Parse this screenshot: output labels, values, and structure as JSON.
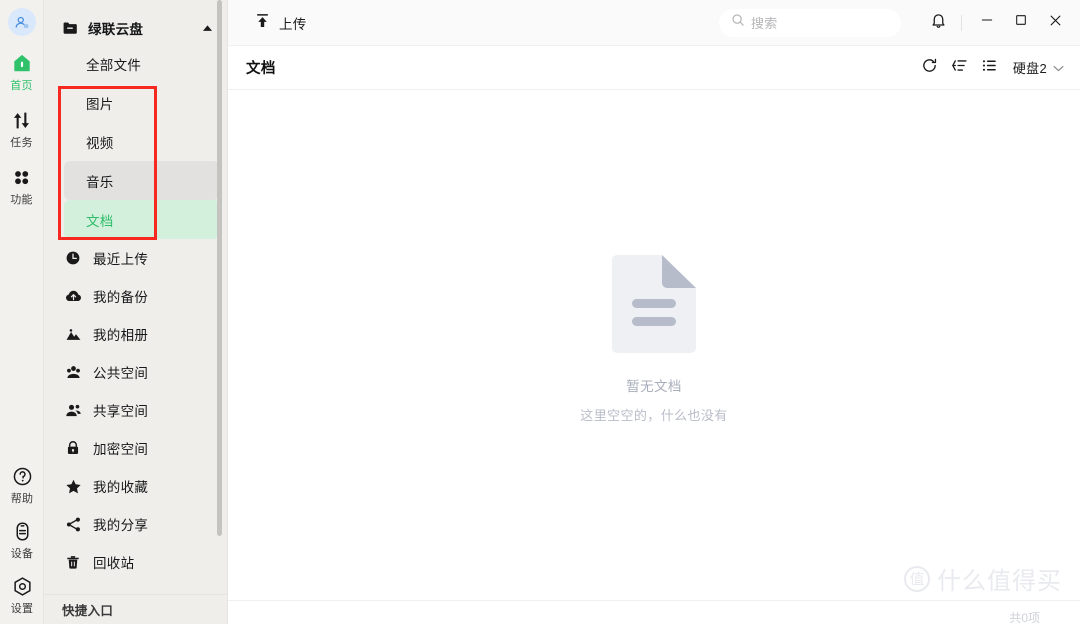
{
  "rail": {
    "avatar_name": "user-avatar",
    "items": [
      {
        "label": "首页",
        "icon": "home-icon",
        "active": true
      },
      {
        "label": "任务",
        "icon": "transfer-icon",
        "active": false
      },
      {
        "label": "功能",
        "icon": "apps-grid-icon",
        "active": false
      }
    ],
    "bottom_items": [
      {
        "label": "帮助",
        "icon": "help-circle-icon"
      },
      {
        "label": "设备",
        "icon": "device-icon"
      },
      {
        "label": "设置",
        "icon": "settings-hex-icon"
      }
    ]
  },
  "sidebar": {
    "header": {
      "title": "绿联云盘",
      "icon": "folder-minus-icon",
      "chevron": "chevron-up-icon"
    },
    "sub_items": [
      {
        "label": "全部文件",
        "state": "normal"
      },
      {
        "label": "图片",
        "state": "normal"
      },
      {
        "label": "视频",
        "state": "normal"
      },
      {
        "label": "音乐",
        "state": "hover"
      },
      {
        "label": "文档",
        "state": "selected"
      }
    ],
    "items": [
      {
        "label": "最近上传",
        "icon": "clock-icon"
      },
      {
        "label": "我的备份",
        "icon": "cloud-icon"
      },
      {
        "label": "我的相册",
        "icon": "photo-mountain-icon"
      },
      {
        "label": "公共空间",
        "icon": "group-public-icon"
      },
      {
        "label": "共享空间",
        "icon": "people-share-icon"
      },
      {
        "label": "加密空间",
        "icon": "lock-icon"
      },
      {
        "label": "我的收藏",
        "icon": "star-icon"
      },
      {
        "label": "我的分享",
        "icon": "share-nodes-icon"
      },
      {
        "label": "回收站",
        "icon": "trash-icon"
      }
    ],
    "footer_label": "快捷入口"
  },
  "titlebar": {
    "upload_label": "上传",
    "upload_icon": "upload-to-line-icon",
    "search_placeholder": "搜索",
    "search_value": "",
    "search_icon": "search-icon",
    "bell_icon": "bell-icon",
    "minimize_icon": "minimize-icon",
    "maximize_icon": "maximize-icon",
    "close_icon": "close-icon"
  },
  "content_header": {
    "page_title": "文档",
    "refresh_icon": "refresh-icon",
    "sort_icon": "sort-ascending-icon",
    "view_icon": "list-view-icon",
    "disk_label": "硬盘2",
    "disk_chevron": "chevron-down-icon"
  },
  "empty_state": {
    "icon": "document-empty-icon",
    "title": "暂无文档",
    "subtitle": "这里空空的，什么也没有"
  },
  "statusbar": {
    "count_label": "共0项"
  },
  "watermark": {
    "badge": "值",
    "text": "什么值得买"
  },
  "colors": {
    "accent_green": "#2fbd67",
    "selected_bg": "#d2f0dc",
    "hover_bg": "#e2e1df",
    "annotation_red": "#f7281f",
    "rail_bg": "#f2f1ee",
    "sidebar_bg": "#efeeeb"
  }
}
